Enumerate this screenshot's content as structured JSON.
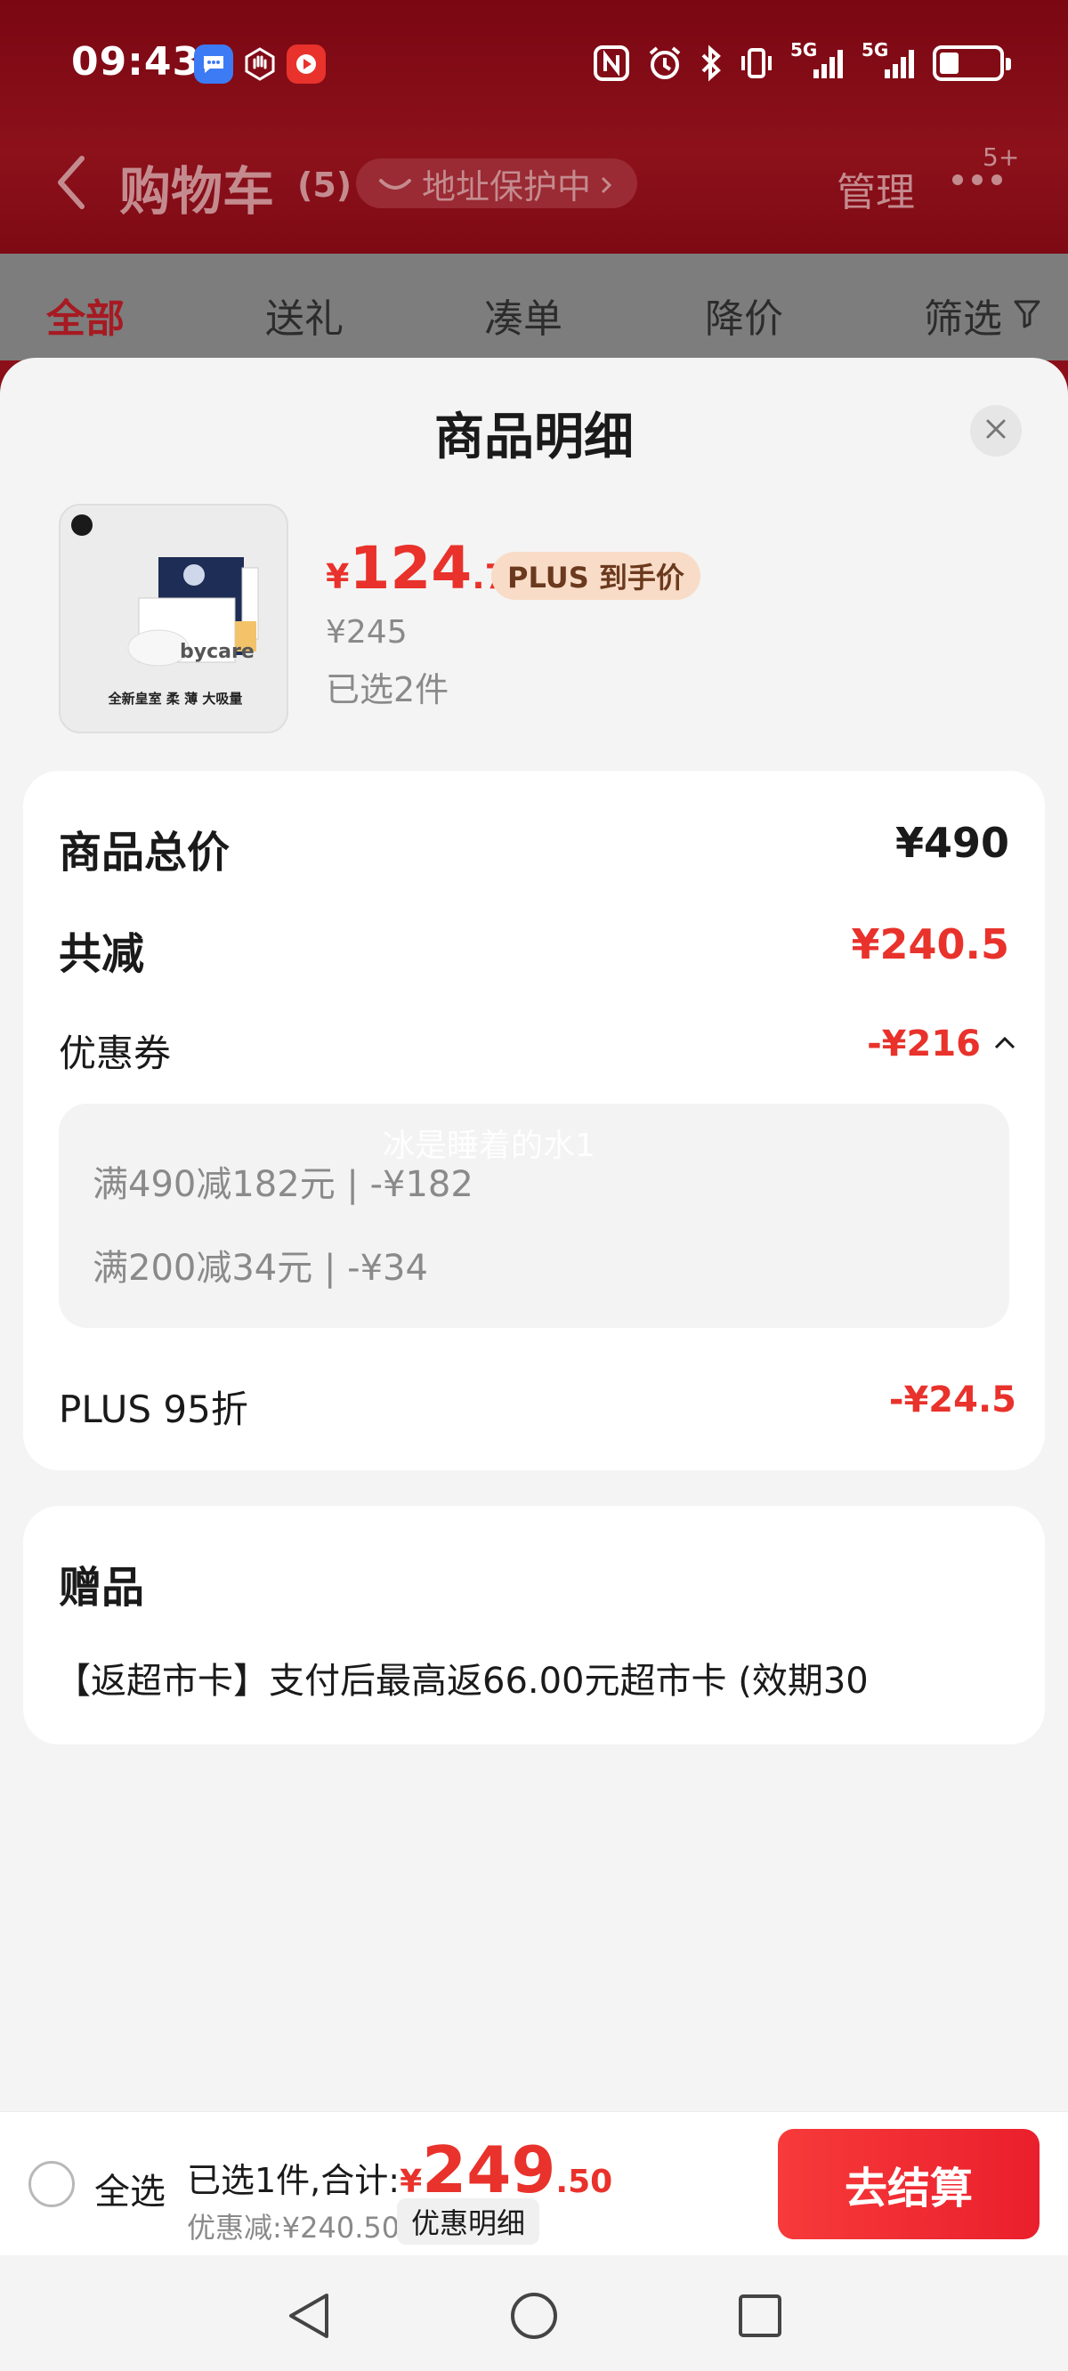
{
  "status_bar": {
    "time": "09:43",
    "network_1": "5G",
    "network_2": "5G",
    "battery_level": 0.32
  },
  "header": {
    "title": "购物车",
    "count": "(5)",
    "address_pill": "地址保护中",
    "manage_label": "管理",
    "more_badge": "5+"
  },
  "tabs": [
    {
      "label": "全部",
      "active": true
    },
    {
      "label": "送礼"
    },
    {
      "label": "凑单"
    },
    {
      "label": "降价"
    },
    {
      "label": "筛选"
    }
  ],
  "sheet": {
    "title": "商品明细",
    "product": {
      "image_text": "全新皇室 柔 薄 大吸量",
      "brand_text": "bycare",
      "price_currency": "¥",
      "price_int": "124",
      "price_dec": ".75",
      "plus_tag": "PLUS 到手价",
      "original_price": "¥245",
      "selected_count": "已选2件"
    },
    "summary": {
      "total_label": "商品总价",
      "total_value": "¥490",
      "reduced_label": "共减",
      "reduced_value": "¥240.5",
      "coupon_label": "优惠券",
      "coupon_value": "-¥216",
      "coupons": [
        "满490减182元 | -¥182",
        "满200减34元 | -¥34"
      ],
      "watermark": "冰是睡着的水1",
      "plus_label": "PLUS 95折",
      "plus_value": "-¥24.5"
    },
    "gift": {
      "title": "赠品",
      "text": "【返超市卡】支付后最高返66.00元超市卡 (效期30"
    }
  },
  "bottom_bar": {
    "select_all": "全选",
    "selected_text": "已选1件,合计:",
    "total_currency": "¥",
    "total_int": "249",
    "total_dec": ".50",
    "discount_text": "优惠减:¥240.50",
    "detail_chip": "优惠明细",
    "checkout": "去结算"
  },
  "colors": {
    "accent_red": "#e8322b",
    "header_bg": "#8a0f18",
    "plus_tag_bg": "#f9dcc7"
  }
}
